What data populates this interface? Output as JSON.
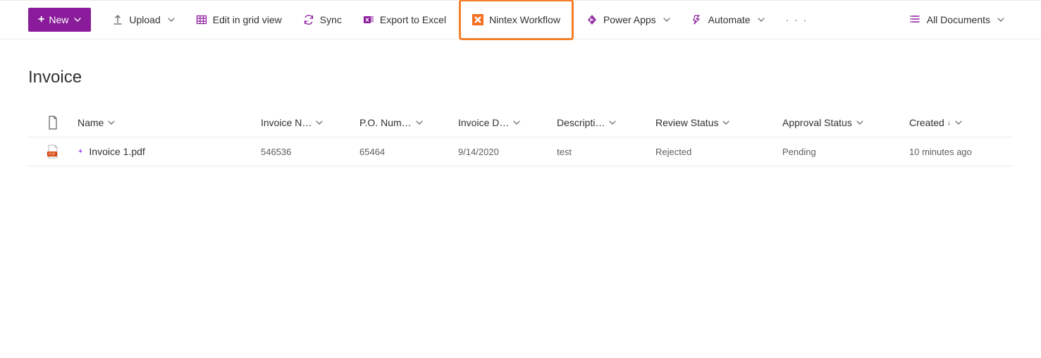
{
  "toolbar": {
    "new_label": "New",
    "upload_label": "Upload",
    "edit_grid_label": "Edit in grid view",
    "sync_label": "Sync",
    "export_excel_label": "Export to Excel",
    "nintex_label": "Nintex Workflow",
    "power_apps_label": "Power Apps",
    "automate_label": "Automate",
    "all_documents_label": "All Documents"
  },
  "page": {
    "title": "Invoice"
  },
  "columns": {
    "name": "Name",
    "invoice_num": "Invoice N…",
    "po_num": "P.O. Num…",
    "invoice_date": "Invoice D…",
    "description": "Descripti…",
    "review_status": "Review Status",
    "approval_status": "Approval Status",
    "created": "Created"
  },
  "rows": [
    {
      "name": "Invoice 1.pdf",
      "invoice_num": "546536",
      "po_num": "65464",
      "invoice_date": "9/14/2020",
      "description": "test",
      "review_status": "Rejected",
      "approval_status": "Pending",
      "created": "10 minutes ago"
    }
  ]
}
